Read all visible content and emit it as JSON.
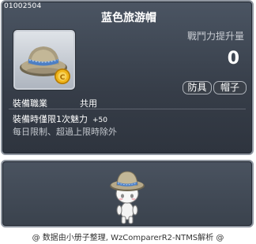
{
  "item": {
    "code": "01002504",
    "name": "蓝色旅游帽",
    "stat_label": "戰鬥力提升量",
    "stat_value": "0",
    "tags": [
      "防具",
      "帽子"
    ],
    "job_label": "裝備職業",
    "job_value": "共用",
    "equip_text": "裝備時僅限1次魅力",
    "equip_number": "+50",
    "limit_text": "每日限制、超過上限時除外"
  },
  "footer": {
    "text": "@ 数据由小册子整理, WzComparerR2-NTMS解析 @"
  },
  "icons": {
    "item_icon": "hat-with-coin-icon",
    "preview": "character-avatar-icon"
  },
  "colors": {
    "tooltip_bg": "#3f4652",
    "border": "#8f96a0",
    "hat_brim": "#b6a98a",
    "hat_band": "#6c9bd8",
    "coin": "#f0b51a"
  }
}
